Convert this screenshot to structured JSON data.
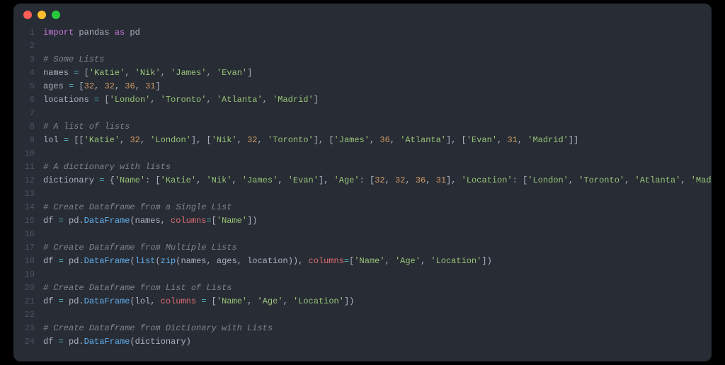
{
  "colors": {
    "bg": "#282c34",
    "text": "#abb2bf",
    "keyword": "#c678dd",
    "string": "#98c379",
    "number": "#d19a66",
    "comment": "#7f848e",
    "function": "#61afef",
    "operator": "#56b6c2",
    "identifier": "#e06c75",
    "gutter": "#4b5263"
  },
  "lines": [
    {
      "n": "1",
      "tokens": [
        {
          "t": "import",
          "c": "kw"
        },
        {
          "t": " pandas ",
          "c": ""
        },
        {
          "t": "as",
          "c": "kw"
        },
        {
          "t": " pd",
          "c": ""
        }
      ]
    },
    {
      "n": "2",
      "tokens": []
    },
    {
      "n": "3",
      "tokens": [
        {
          "t": "# Some Lists",
          "c": "com"
        }
      ]
    },
    {
      "n": "4",
      "tokens": [
        {
          "t": "names ",
          "c": ""
        },
        {
          "t": "=",
          "c": "op"
        },
        {
          "t": " [",
          "c": ""
        },
        {
          "t": "'Katie'",
          "c": "str"
        },
        {
          "t": ", ",
          "c": ""
        },
        {
          "t": "'Nik'",
          "c": "str"
        },
        {
          "t": ", ",
          "c": ""
        },
        {
          "t": "'James'",
          "c": "str"
        },
        {
          "t": ", ",
          "c": ""
        },
        {
          "t": "'Evan'",
          "c": "str"
        },
        {
          "t": "]",
          "c": ""
        }
      ]
    },
    {
      "n": "5",
      "tokens": [
        {
          "t": "ages ",
          "c": ""
        },
        {
          "t": "=",
          "c": "op"
        },
        {
          "t": " [",
          "c": ""
        },
        {
          "t": "32",
          "c": "num"
        },
        {
          "t": ", ",
          "c": ""
        },
        {
          "t": "32",
          "c": "num"
        },
        {
          "t": ", ",
          "c": ""
        },
        {
          "t": "36",
          "c": "num"
        },
        {
          "t": ", ",
          "c": ""
        },
        {
          "t": "31",
          "c": "num"
        },
        {
          "t": "]",
          "c": ""
        }
      ]
    },
    {
      "n": "6",
      "tokens": [
        {
          "t": "locations ",
          "c": ""
        },
        {
          "t": "=",
          "c": "op"
        },
        {
          "t": " [",
          "c": ""
        },
        {
          "t": "'London'",
          "c": "str"
        },
        {
          "t": ", ",
          "c": ""
        },
        {
          "t": "'Toronto'",
          "c": "str"
        },
        {
          "t": ", ",
          "c": ""
        },
        {
          "t": "'Atlanta'",
          "c": "str"
        },
        {
          "t": ", ",
          "c": ""
        },
        {
          "t": "'Madrid'",
          "c": "str"
        },
        {
          "t": "]",
          "c": ""
        }
      ]
    },
    {
      "n": "7",
      "tokens": []
    },
    {
      "n": "8",
      "tokens": [
        {
          "t": "# A list of lists",
          "c": "com"
        }
      ]
    },
    {
      "n": "9",
      "tokens": [
        {
          "t": "lol ",
          "c": ""
        },
        {
          "t": "=",
          "c": "op"
        },
        {
          "t": " [[",
          "c": ""
        },
        {
          "t": "'Katie'",
          "c": "str"
        },
        {
          "t": ", ",
          "c": ""
        },
        {
          "t": "32",
          "c": "num"
        },
        {
          "t": ", ",
          "c": ""
        },
        {
          "t": "'London'",
          "c": "str"
        },
        {
          "t": "], [",
          "c": ""
        },
        {
          "t": "'Nik'",
          "c": "str"
        },
        {
          "t": ", ",
          "c": ""
        },
        {
          "t": "32",
          "c": "num"
        },
        {
          "t": ", ",
          "c": ""
        },
        {
          "t": "'Toronto'",
          "c": "str"
        },
        {
          "t": "], [",
          "c": ""
        },
        {
          "t": "'James'",
          "c": "str"
        },
        {
          "t": ", ",
          "c": ""
        },
        {
          "t": "36",
          "c": "num"
        },
        {
          "t": ", ",
          "c": ""
        },
        {
          "t": "'Atlanta'",
          "c": "str"
        },
        {
          "t": "], [",
          "c": ""
        },
        {
          "t": "'Evan'",
          "c": "str"
        },
        {
          "t": ", ",
          "c": ""
        },
        {
          "t": "31",
          "c": "num"
        },
        {
          "t": ", ",
          "c": ""
        },
        {
          "t": "'Madrid'",
          "c": "str"
        },
        {
          "t": "]]",
          "c": ""
        }
      ]
    },
    {
      "n": "10",
      "tokens": []
    },
    {
      "n": "11",
      "tokens": [
        {
          "t": "# A dictionary with lists",
          "c": "com"
        }
      ]
    },
    {
      "n": "12",
      "tokens": [
        {
          "t": "dictionary ",
          "c": ""
        },
        {
          "t": "=",
          "c": "op"
        },
        {
          "t": " {",
          "c": ""
        },
        {
          "t": "'Name'",
          "c": "str"
        },
        {
          "t": ": [",
          "c": ""
        },
        {
          "t": "'Katie'",
          "c": "str"
        },
        {
          "t": ", ",
          "c": ""
        },
        {
          "t": "'Nik'",
          "c": "str"
        },
        {
          "t": ", ",
          "c": ""
        },
        {
          "t": "'James'",
          "c": "str"
        },
        {
          "t": ", ",
          "c": ""
        },
        {
          "t": "'Evan'",
          "c": "str"
        },
        {
          "t": "], ",
          "c": ""
        },
        {
          "t": "'Age'",
          "c": "str"
        },
        {
          "t": ": [",
          "c": ""
        },
        {
          "t": "32",
          "c": "num"
        },
        {
          "t": ", ",
          "c": ""
        },
        {
          "t": "32",
          "c": "num"
        },
        {
          "t": ", ",
          "c": ""
        },
        {
          "t": "36",
          "c": "num"
        },
        {
          "t": ", ",
          "c": ""
        },
        {
          "t": "31",
          "c": "num"
        },
        {
          "t": "], ",
          "c": ""
        },
        {
          "t": "'Location'",
          "c": "str"
        },
        {
          "t": ": [",
          "c": ""
        },
        {
          "t": "'London'",
          "c": "str"
        },
        {
          "t": ", ",
          "c": ""
        },
        {
          "t": "'Toronto'",
          "c": "str"
        },
        {
          "t": ", ",
          "c": ""
        },
        {
          "t": "'Atlanta'",
          "c": "str"
        },
        {
          "t": ", ",
          "c": ""
        },
        {
          "t": "'Madrid'",
          "c": "str"
        },
        {
          "t": "]}",
          "c": ""
        }
      ]
    },
    {
      "n": "13",
      "tokens": []
    },
    {
      "n": "14",
      "tokens": [
        {
          "t": "# Create Dataframe from a Single List",
          "c": "com"
        }
      ]
    },
    {
      "n": "15",
      "tokens": [
        {
          "t": "df ",
          "c": ""
        },
        {
          "t": "=",
          "c": "op"
        },
        {
          "t": " pd.",
          "c": ""
        },
        {
          "t": "DataFrame",
          "c": "fn"
        },
        {
          "t": "(names, ",
          "c": ""
        },
        {
          "t": "columns",
          "c": "ident"
        },
        {
          "t": "=",
          "c": "op"
        },
        {
          "t": "[",
          "c": ""
        },
        {
          "t": "'Name'",
          "c": "str"
        },
        {
          "t": "])",
          "c": ""
        }
      ]
    },
    {
      "n": "16",
      "tokens": []
    },
    {
      "n": "17",
      "tokens": [
        {
          "t": "# Create Dataframe from Multiple Lists",
          "c": "com"
        }
      ]
    },
    {
      "n": "18",
      "tokens": [
        {
          "t": "df ",
          "c": ""
        },
        {
          "t": "=",
          "c": "op"
        },
        {
          "t": " pd.",
          "c": ""
        },
        {
          "t": "DataFrame",
          "c": "fn"
        },
        {
          "t": "(",
          "c": ""
        },
        {
          "t": "list",
          "c": "fn"
        },
        {
          "t": "(",
          "c": ""
        },
        {
          "t": "zip",
          "c": "fn"
        },
        {
          "t": "(names, ages, location)), ",
          "c": ""
        },
        {
          "t": "columns",
          "c": "ident"
        },
        {
          "t": "=",
          "c": "op"
        },
        {
          "t": "[",
          "c": ""
        },
        {
          "t": "'Name'",
          "c": "str"
        },
        {
          "t": ", ",
          "c": ""
        },
        {
          "t": "'Age'",
          "c": "str"
        },
        {
          "t": ", ",
          "c": ""
        },
        {
          "t": "'Location'",
          "c": "str"
        },
        {
          "t": "])",
          "c": ""
        }
      ]
    },
    {
      "n": "19",
      "tokens": []
    },
    {
      "n": "20",
      "tokens": [
        {
          "t": "# Create Dataframe from List of Lists",
          "c": "com"
        }
      ]
    },
    {
      "n": "21",
      "tokens": [
        {
          "t": "df ",
          "c": ""
        },
        {
          "t": "=",
          "c": "op"
        },
        {
          "t": " pd.",
          "c": ""
        },
        {
          "t": "DataFrame",
          "c": "fn"
        },
        {
          "t": "(lol, ",
          "c": ""
        },
        {
          "t": "columns",
          "c": "ident"
        },
        {
          "t": " ",
          "c": ""
        },
        {
          "t": "=",
          "c": "op"
        },
        {
          "t": " [",
          "c": ""
        },
        {
          "t": "'Name'",
          "c": "str"
        },
        {
          "t": ", ",
          "c": ""
        },
        {
          "t": "'Age'",
          "c": "str"
        },
        {
          "t": ", ",
          "c": ""
        },
        {
          "t": "'Location'",
          "c": "str"
        },
        {
          "t": "])",
          "c": ""
        }
      ]
    },
    {
      "n": "22",
      "tokens": []
    },
    {
      "n": "23",
      "tokens": [
        {
          "t": "# Create Dataframe from Dictionary with Lists",
          "c": "com"
        }
      ]
    },
    {
      "n": "24",
      "tokens": [
        {
          "t": "df ",
          "c": ""
        },
        {
          "t": "=",
          "c": "op"
        },
        {
          "t": " pd.",
          "c": ""
        },
        {
          "t": "DataFrame",
          "c": "fn"
        },
        {
          "t": "(dictionary)",
          "c": ""
        }
      ]
    }
  ]
}
